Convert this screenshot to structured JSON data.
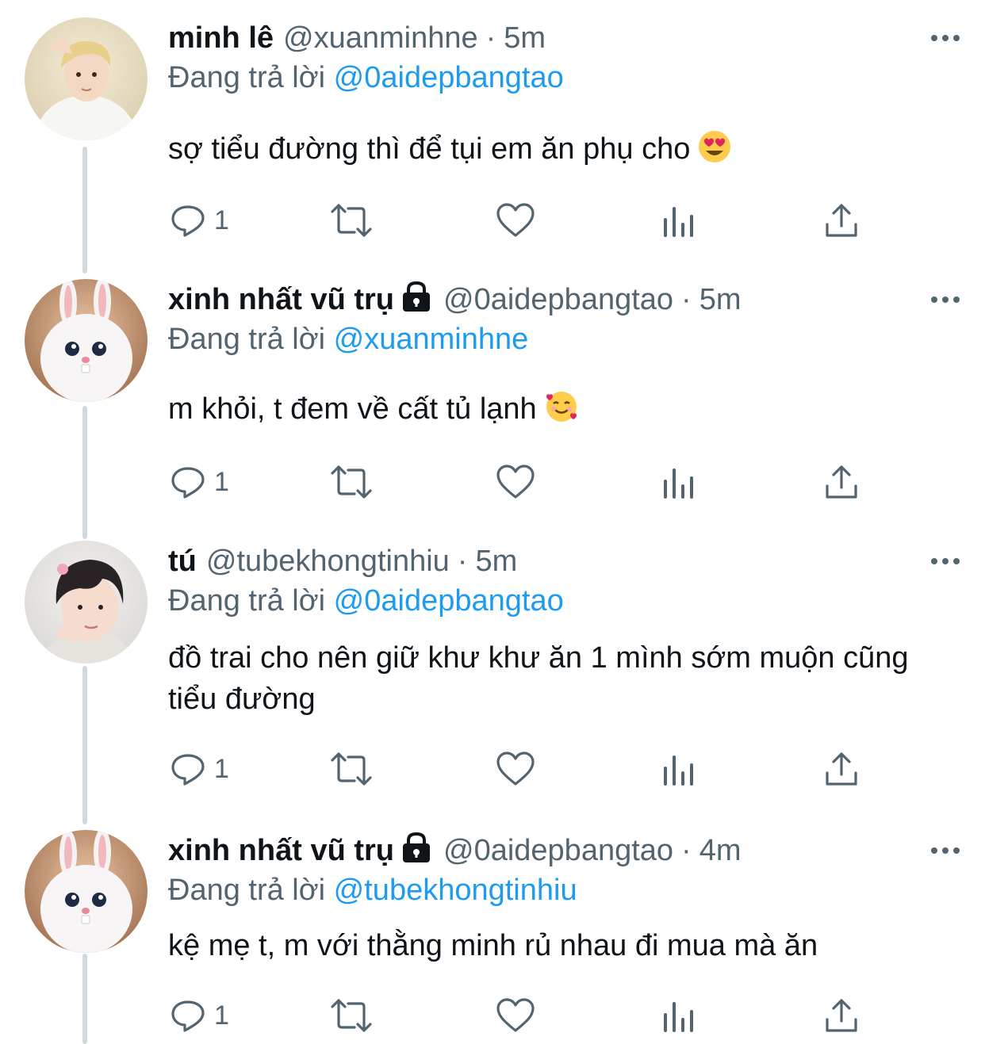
{
  "colors": {
    "text": "#0f1419",
    "secondary": "#536471",
    "mention": "#1d9bf0",
    "thread_line": "#cfd9de",
    "icon": "#536471"
  },
  "tweets": [
    {
      "name": "minh lê",
      "handle": "@xuanminhne",
      "dot": "·",
      "time": "5m",
      "locked": false,
      "avatar": "blond-boy-avatar",
      "replying_prefix": "Đang trả lời",
      "replying_to": "@0aidepbangtao",
      "text": "sợ tiểu đường thì để tụi em ăn phụ cho",
      "emoji": "heart-eyes-emoji",
      "reply_count": "1"
    },
    {
      "name": "xinh nhất vũ trụ",
      "handle": "@0aidepbangtao",
      "dot": "·",
      "time": "5m",
      "locked": true,
      "avatar": "white-bunny-avatar",
      "replying_prefix": "Đang trả lời",
      "replying_to": "@xuanminhne",
      "text": "m khỏi, t đem về cất tủ lạnh",
      "emoji": "smiling-hearts-emoji",
      "reply_count": "1"
    },
    {
      "name": "tú",
      "handle": "@tubekhongtinhiu",
      "dot": "·",
      "time": "5m",
      "locked": false,
      "avatar": "dark-hair-boy-avatar",
      "replying_prefix": "Đang trả lời",
      "replying_to": "@0aidepbangtao",
      "text": "đồ trai cho nên giữ khư khư ăn 1 mình sớm muộn cũng tiểu đường",
      "emoji": "",
      "reply_count": "1"
    },
    {
      "name": "xinh nhất vũ trụ",
      "handle": "@0aidepbangtao",
      "dot": "·",
      "time": "4m",
      "locked": true,
      "avatar": "white-bunny-avatar",
      "replying_prefix": "Đang trả lời",
      "replying_to": "@tubekhongtinhiu",
      "text": "kệ mẹ t, m với thằng minh rủ nhau đi mua mà ăn",
      "emoji": "",
      "reply_count": "1"
    }
  ]
}
